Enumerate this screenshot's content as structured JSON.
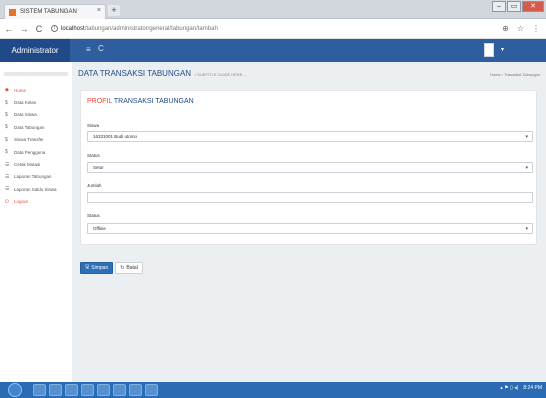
{
  "browser": {
    "tab_title": "SISTEM TABUNGAN",
    "tab_close": "×",
    "new_tab": "+",
    "url_host": "localhost",
    "url_path": "/tabungan/administrator/general/tabungan/tambah",
    "back": "←",
    "forward": "→",
    "reload": "C",
    "zoom_icon": "⊕",
    "star_icon": "☆",
    "menu_icon": "⋮"
  },
  "header": {
    "brand": "Administrator",
    "hamburger": "≡",
    "refresh": "C",
    "user_caret": "▾"
  },
  "sidebar": {
    "items": [
      {
        "icon": "◆",
        "label": "Home",
        "active": true
      },
      {
        "icon": "$",
        "label": "Data Kelas"
      },
      {
        "icon": "$",
        "label": "Data Siswa"
      },
      {
        "icon": "$",
        "label": "Data Tabungan"
      },
      {
        "icon": "$",
        "label": "Siswa Transfer"
      },
      {
        "icon": "$",
        "label": "Data Pengguna"
      },
      {
        "icon": "☰",
        "label": "Cetak Mutasi"
      },
      {
        "icon": "☰",
        "label": "Laporan Tabungan"
      },
      {
        "icon": "☰",
        "label": "Laporan Saldo Siswa"
      },
      {
        "icon": "⏻",
        "label": "Logout"
      }
    ]
  },
  "page": {
    "title": "DATA TRANSAKSI TABUNGAN",
    "subtitle": "/ SUBTITLE GUIDE HERE...",
    "breadcrumb": "Home › Transaksi Tabungan"
  },
  "form": {
    "box_title_a": "PROFIL",
    "box_title_b": "TRANSAKSI TABUNGAN",
    "siswa_label": "Siswa",
    "siswa_value": "16331001 Budi utomo",
    "status_label": "Status",
    "status_value": "Setor",
    "jumlah_label": "Jumlah",
    "jumlah_value": "",
    "status2_label": "Status",
    "status2_value": "Offline",
    "caret": "▾"
  },
  "actions": {
    "save_icon": "🖫",
    "save_label": "Simpan",
    "reset_icon": "↻",
    "reset_label": "Batal"
  },
  "taskbar": {
    "time": "8:24 PM",
    "tray_icons": "▴ ⚑ ▯ ◂)"
  }
}
